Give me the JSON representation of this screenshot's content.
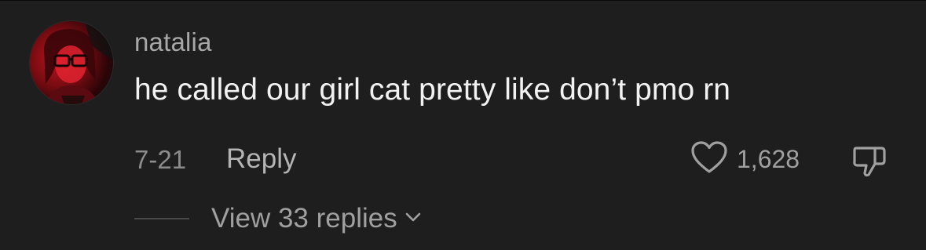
{
  "comment": {
    "username": "natalia",
    "text": "he called our girl cat pretty like don’t pmo rn",
    "date": "7-21",
    "reply_label": "Reply",
    "like_count": "1,628",
    "view_replies_label": "View 33 replies"
  },
  "icons": {
    "avatar": "profile-photo",
    "like": "heart-icon",
    "dislike": "thumbs-down-icon",
    "expand": "chevron-down-icon"
  },
  "colors": {
    "background": "#1e1e1e",
    "username": "#a8a8a8",
    "text": "#f2f2f2",
    "muted": "#8c8c8c"
  }
}
